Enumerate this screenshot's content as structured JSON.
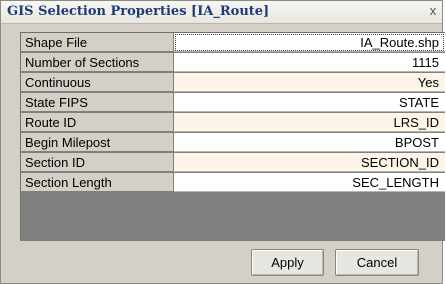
{
  "window": {
    "title": "GIS Selection Properties  [IA_Route]",
    "close_glyph": "x"
  },
  "properties": [
    {
      "label": "Shape File",
      "value": "IA_Route.shp"
    },
    {
      "label": "Number of Sections",
      "value": "1115"
    },
    {
      "label": "Continuous",
      "value": "Yes"
    },
    {
      "label": "State FIPS",
      "value": "STATE"
    },
    {
      "label": "Route ID",
      "value": "LRS_ID"
    },
    {
      "label": "Begin Milepost",
      "value": "BPOST"
    },
    {
      "label": "Section ID",
      "value": "SECTION_ID"
    },
    {
      "label": "Section Length",
      "value": "SEC_LENGTH"
    }
  ],
  "buttons": {
    "apply_label": "Apply",
    "cancel_label": "Cancel"
  },
  "colors": {
    "title_text": "#1f3a7a",
    "label_background": "#d4d0c8",
    "value_alt_background": "#fdf4e8",
    "grid_empty_area": "#808080"
  }
}
